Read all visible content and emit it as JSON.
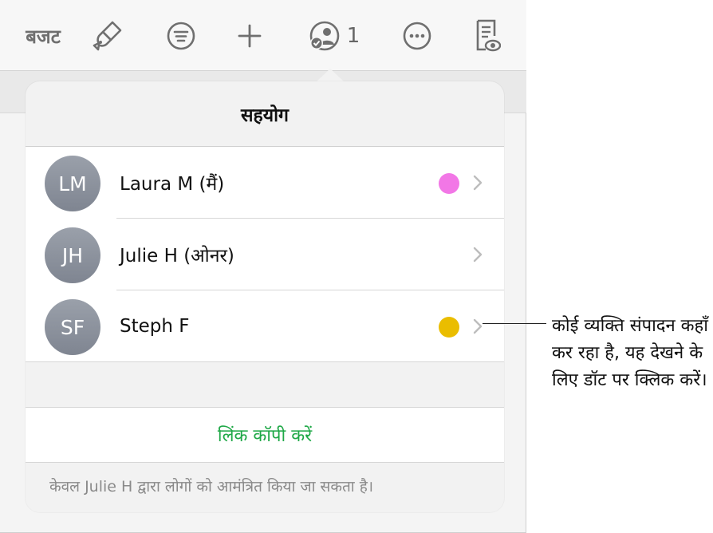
{
  "toolbar": {
    "budget_label": "बजट",
    "collab_count": "1",
    "icons": [
      "paintbrush-icon",
      "format-icon",
      "add-icon",
      "collaborate-icon",
      "more-icon",
      "reader-view-icon"
    ]
  },
  "popover": {
    "title": "सहयोग",
    "participants": [
      {
        "initials": "LM",
        "name": "Laura M (मैं)",
        "dot_color": "#f277e6"
      },
      {
        "initials": "JH",
        "name": "Julie H (ओनर)",
        "dot_color": ""
      },
      {
        "initials": "SF",
        "name": "Steph F",
        "dot_color": "#eabd00"
      }
    ],
    "copy_link": "लिंक कॉपी करें",
    "footnote": "केवल Julie H द्वारा लोगों को आमंत्रित किया जा सकता है।"
  },
  "callout": {
    "text": "कोई व्यक्ति संपादन कहाँ कर रहा है, यह देखने के लिए डॉट पर क्लिक करें।"
  }
}
